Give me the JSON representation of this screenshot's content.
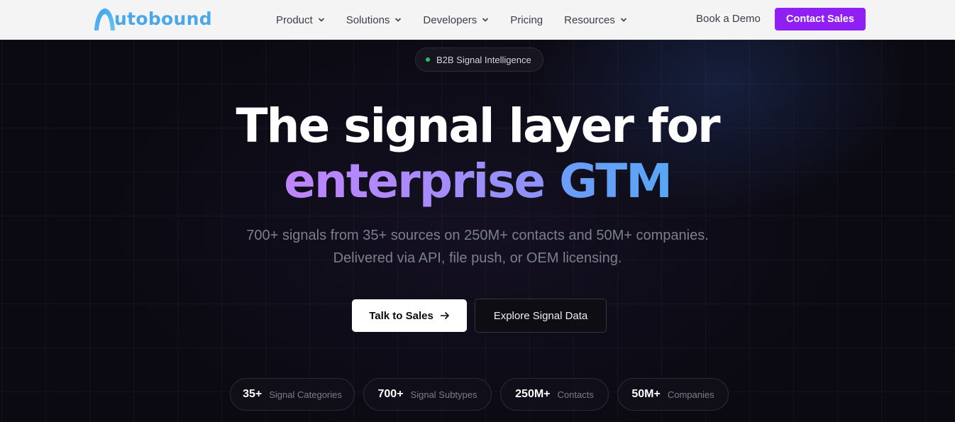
{
  "brand": {
    "logo_text": "utobound",
    "accent": "#8f1ff2",
    "logo_color": "#4aa7ea"
  },
  "nav": {
    "items": [
      {
        "label": "Product",
        "has_dropdown": true
      },
      {
        "label": "Solutions",
        "has_dropdown": true
      },
      {
        "label": "Developers",
        "has_dropdown": true
      },
      {
        "label": "Pricing",
        "has_dropdown": false
      },
      {
        "label": "Resources",
        "has_dropdown": true
      }
    ],
    "book_demo": "Book a Demo",
    "contact_sales": "Contact Sales"
  },
  "hero": {
    "badge": "B2B Signal Intelligence",
    "headline_line1": "The signal layer for",
    "headline_word_purple": "enterprise",
    "headline_word_blue": "GTM",
    "subtext_line1": "700+ signals from 35+ sources on 250M+ contacts and 50M+ companies.",
    "subtext_line2": "Delivered via API, file push, or OEM licensing.",
    "primary_cta": "Talk to Sales",
    "secondary_cta": "Explore Signal Data"
  },
  "stats": [
    {
      "value": "35+",
      "label": "Signal Categories"
    },
    {
      "value": "700+",
      "label": "Signal Subtypes"
    },
    {
      "value": "250M+",
      "label": "Contacts"
    },
    {
      "value": "50M+",
      "label": "Companies"
    }
  ]
}
